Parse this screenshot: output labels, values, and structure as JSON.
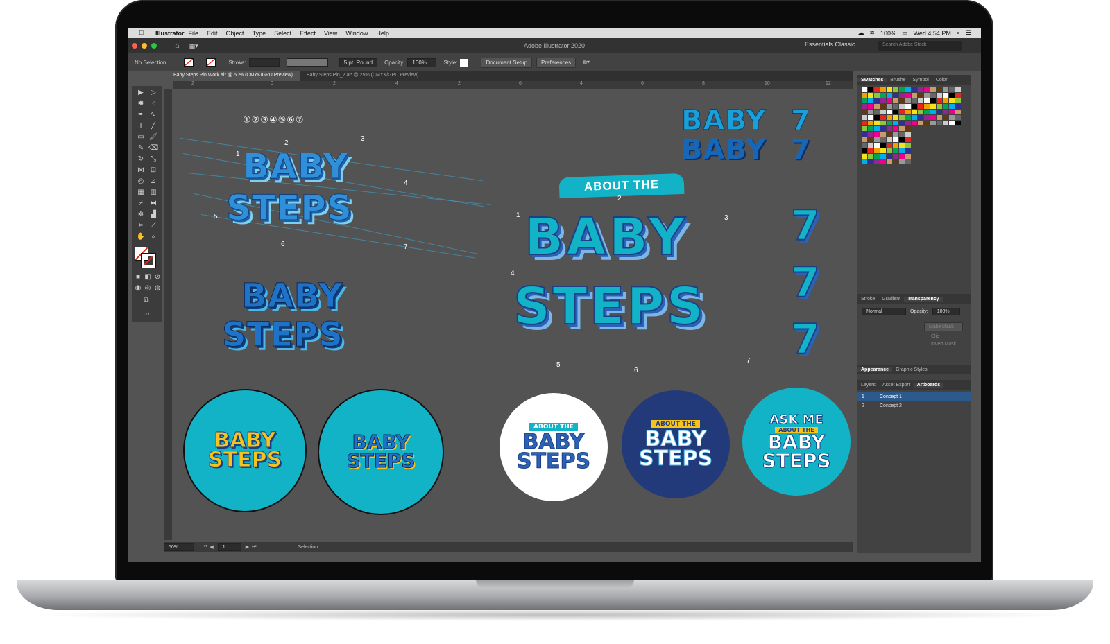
{
  "menubar": {
    "app": "Illustrator",
    "items": [
      "File",
      "Edit",
      "Object",
      "Type",
      "Select",
      "Effect",
      "View",
      "Window",
      "Help"
    ],
    "battery": "100%",
    "clock": "Wed 4:54 PM"
  },
  "window": {
    "title": "Adobe Illustrator 2020",
    "workspace": "Essentials Classic",
    "stock_placeholder": "Search Adobe Stock"
  },
  "control": {
    "selection": "No Selection",
    "stroke_label": "Stroke:",
    "brush": "5 pt. Round",
    "opacity_label": "Opacity:",
    "opacity": "100%",
    "style_label": "Style:",
    "doc_setup": "Document Setup",
    "preferences": "Preferences"
  },
  "tabs": [
    "Baby Steps Pin Work.ai* @ 50% (CMYK/GPU Preview)",
    "Baby Steps Pin_2.ai* @ 25% (CMYK/GPU Preview)"
  ],
  "ruler": [
    "2",
    "0",
    "2",
    "4",
    "6",
    "8",
    "10",
    "12",
    "0",
    "2",
    "4",
    "6",
    "8",
    "10",
    "12"
  ],
  "status": {
    "zoom": "50%",
    "artboard": "1",
    "tool": "Selection"
  },
  "panels": {
    "top_tabs": [
      "Swatches",
      "Brushe",
      "Symbol",
      "Color"
    ],
    "mid_tabs": [
      "Stroke",
      "Gradient",
      "Transparency"
    ],
    "blend": "Normal",
    "opacity_label": "Opacity:",
    "opacity": "100%",
    "make_mask": "Make Mask",
    "clip": "Clip",
    "invert_mask": "Invert Mask",
    "appearance_tabs": [
      "Appearance",
      "Graphic Styles"
    ],
    "layer_tabs": [
      "Layers",
      "Asset Export",
      "Artboards"
    ],
    "artboards": [
      {
        "num": "1",
        "name": "Concept 1"
      },
      {
        "num": "2",
        "name": "Concept 2"
      }
    ]
  },
  "artwork": {
    "numbers_row": "①②③④⑤⑥⑦",
    "baby": "BABY",
    "steps": "STEPS",
    "seven": "7",
    "about_the": "ABOUT THE",
    "about_the_small": "ABOUT THE",
    "ask_me": "ASK ME",
    "callouts": [
      "1",
      "2",
      "3",
      "4",
      "5",
      "6",
      "7"
    ]
  },
  "colors": {
    "screen_bg": "#535353",
    "teal": "#12b3c6",
    "navy": "#233a7a",
    "blue": "#1e73c8",
    "yellow": "#f6c31c"
  }
}
